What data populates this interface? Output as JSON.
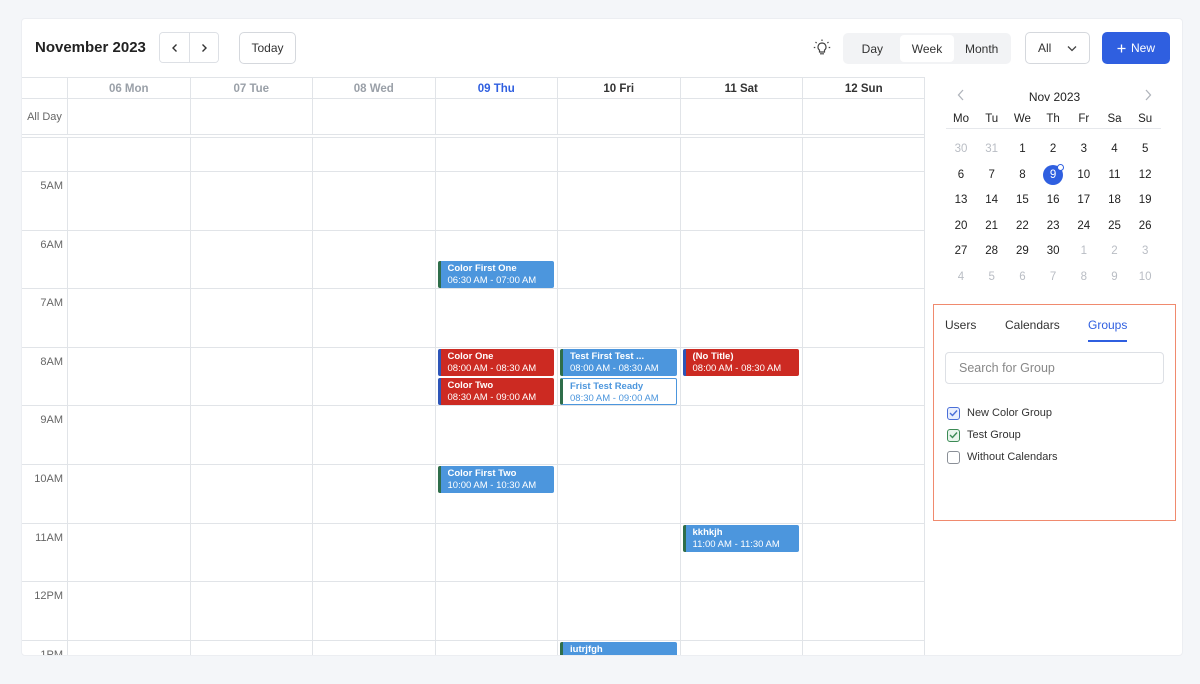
{
  "header": {
    "title": "November 2023",
    "prev_icon": "chevron-left-icon",
    "next_icon": "chevron-right-icon",
    "today_label": "Today",
    "theme_icon": "lightbulb-icon",
    "views": [
      {
        "label": "Day",
        "active": false
      },
      {
        "label": "Week",
        "active": true
      },
      {
        "label": "Month",
        "active": false
      }
    ],
    "filter_value": "All",
    "new_label": "New"
  },
  "days": [
    {
      "label": "06 Mon",
      "state": "past"
    },
    {
      "label": "07 Tue",
      "state": "past"
    },
    {
      "label": "08 Wed",
      "state": "past"
    },
    {
      "label": "09 Thu",
      "state": "today"
    },
    {
      "label": "10 Fri",
      "state": "upcoming"
    },
    {
      "label": "11 Sat",
      "state": "upcoming"
    },
    {
      "label": "12 Sun",
      "state": "upcoming"
    }
  ],
  "all_day_label": "All Day",
  "hours": [
    "",
    "5AM",
    "6AM",
    "7AM",
    "8AM",
    "9AM",
    "10AM",
    "11AM",
    "12PM",
    "1PM"
  ],
  "events": [
    {
      "day": 3,
      "start": "06:30",
      "end": "07:00",
      "title": "Color First One",
      "time": "06:30 AM - 07:00 AM",
      "style": "blue"
    },
    {
      "day": 3,
      "start": "08:00",
      "end": "08:30",
      "title": "Color One",
      "time": "08:00 AM - 08:30 AM",
      "style": "red"
    },
    {
      "day": 3,
      "start": "08:30",
      "end": "09:00",
      "title": "Color Two",
      "time": "08:30 AM - 09:00 AM",
      "style": "red"
    },
    {
      "day": 3,
      "start": "10:00",
      "end": "10:30",
      "title": "Color First Two",
      "time": "10:00 AM - 10:30 AM",
      "style": "blue"
    },
    {
      "day": 4,
      "start": "08:00",
      "end": "08:30",
      "title": "Test First Test ...",
      "time": "08:00 AM - 08:30 AM",
      "style": "blue"
    },
    {
      "day": 4,
      "start": "08:30",
      "end": "09:00",
      "title": "Frist Test Ready",
      "time": "08:30 AM - 09:00 AM",
      "style": "outline"
    },
    {
      "day": 4,
      "start": "13:00",
      "end": "13:30",
      "title": "iutrjfgh",
      "time": "",
      "style": "blue"
    },
    {
      "day": 5,
      "start": "08:00",
      "end": "08:30",
      "title": "(No Title)",
      "time": "08:00 AM - 08:30 AM",
      "style": "red"
    },
    {
      "day": 5,
      "start": "11:00",
      "end": "11:30",
      "title": "kkhkjh",
      "time": "11:00 AM - 11:30 AM",
      "style": "blue"
    }
  ],
  "mini_calendar": {
    "title": "Nov 2023",
    "weekdays": [
      "Mo",
      "Tu",
      "We",
      "Th",
      "Fr",
      "Sa",
      "Su"
    ],
    "weeks": [
      [
        {
          "d": "30",
          "m": true
        },
        {
          "d": "31",
          "m": true
        },
        {
          "d": "1"
        },
        {
          "d": "2"
        },
        {
          "d": "3"
        },
        {
          "d": "4"
        },
        {
          "d": "5"
        }
      ],
      [
        {
          "d": "6"
        },
        {
          "d": "7"
        },
        {
          "d": "8"
        },
        {
          "d": "9",
          "sel": true
        },
        {
          "d": "10"
        },
        {
          "d": "11"
        },
        {
          "d": "12"
        }
      ],
      [
        {
          "d": "13"
        },
        {
          "d": "14"
        },
        {
          "d": "15"
        },
        {
          "d": "16"
        },
        {
          "d": "17"
        },
        {
          "d": "18"
        },
        {
          "d": "19"
        }
      ],
      [
        {
          "d": "20"
        },
        {
          "d": "21"
        },
        {
          "d": "22"
        },
        {
          "d": "23"
        },
        {
          "d": "24"
        },
        {
          "d": "25"
        },
        {
          "d": "26"
        }
      ],
      [
        {
          "d": "27"
        },
        {
          "d": "28"
        },
        {
          "d": "29"
        },
        {
          "d": "30"
        },
        {
          "d": "1",
          "m": true
        },
        {
          "d": "2",
          "m": true
        },
        {
          "d": "3",
          "m": true
        }
      ],
      [
        {
          "d": "4",
          "m": true
        },
        {
          "d": "5",
          "m": true
        },
        {
          "d": "6",
          "m": true
        },
        {
          "d": "7",
          "m": true
        },
        {
          "d": "8",
          "m": true
        },
        {
          "d": "9",
          "m": true
        },
        {
          "d": "10",
          "m": true
        }
      ]
    ]
  },
  "filter_panel": {
    "tabs": [
      {
        "label": "Users",
        "active": false
      },
      {
        "label": "Calendars",
        "active": false
      },
      {
        "label": "Groups",
        "active": true
      }
    ],
    "search_placeholder": "Search for Group",
    "groups": [
      {
        "label": "New Color Group",
        "checked": true,
        "color": "blue"
      },
      {
        "label": "Test Group",
        "checked": true,
        "color": "green"
      },
      {
        "label": "Without Calendars",
        "checked": false,
        "color": "none"
      }
    ]
  }
}
